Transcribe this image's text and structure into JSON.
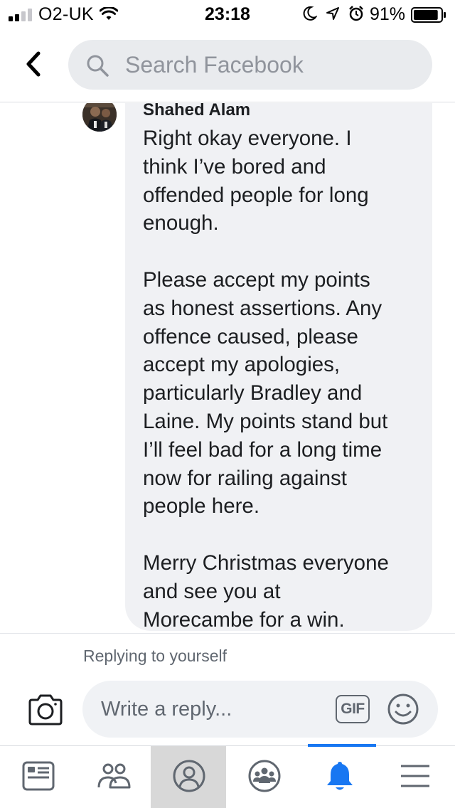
{
  "status_bar": {
    "carrier": "O2-UK",
    "time": "23:18",
    "battery_percent": "91%",
    "battery_level": 0.91,
    "signal_bars": 2,
    "icons": [
      "signal-icon",
      "wifi-icon",
      "moon-icon",
      "location-icon",
      "alarm-icon",
      "battery-icon"
    ]
  },
  "header": {
    "back_icon": "chevron-left-icon",
    "search_placeholder": "Search Facebook",
    "search_icon": "search-icon"
  },
  "comment": {
    "author": "Shahed Alam",
    "text": "Right okay everyone. I\nthink I’ve bored and\noffended people for long\nenough.\n\nPlease accept my points\nas honest assertions. Any\noffence caused, please\naccept my apologies,\nparticularly Bradley and\nLaine. My points stand but\nI’ll feel bad for a long time\nnow for railing against\npeople here.\n\nMerry Christmas everyone\nand see you at\nMorecambe for a win."
  },
  "reply": {
    "replying_to": "Replying to yourself",
    "placeholder": "Write a reply...",
    "gif_label": "GIF",
    "camera_icon": "camera-icon",
    "emoji_icon": "smiley-icon"
  },
  "tab_bar": {
    "tabs": [
      {
        "icon": "news-feed-icon",
        "active": false
      },
      {
        "icon": "friends-icon",
        "active": false
      },
      {
        "icon": "profile-icon",
        "active": false,
        "highlighted": true
      },
      {
        "icon": "groups-icon",
        "active": false
      },
      {
        "icon": "notifications-bell-icon",
        "active": true
      },
      {
        "icon": "menu-icon",
        "active": false
      }
    ],
    "accent_color": "#1877f2"
  },
  "colors": {
    "bubble": "#f0f1f4",
    "secondary_text": "#606770",
    "search_bg": "#e9ebee"
  }
}
